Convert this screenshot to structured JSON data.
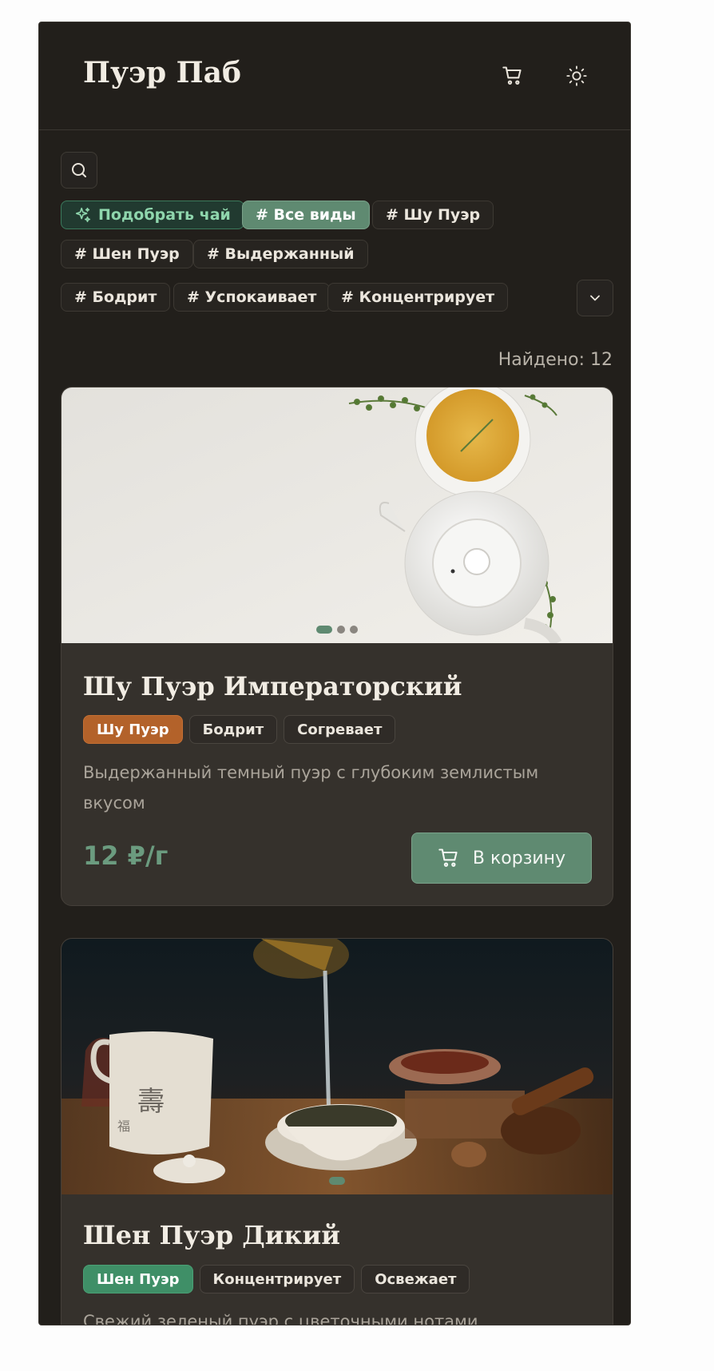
{
  "header": {
    "logo": "Пуэр Паб",
    "cart_icon": "cart-icon",
    "theme_icon": "sun-icon"
  },
  "filters": {
    "ai_label": "Подобрать чай",
    "chips": [
      "# Все виды",
      "# Шу Пуэр",
      "# Шен Пуэр",
      "# Выдержанный",
      "# Бодрит",
      "# Успокаивает",
      "# Концентрирует"
    ],
    "active_chip": "# Все виды"
  },
  "results": {
    "found_label": "Найдено: 12"
  },
  "products": [
    {
      "title": "Шу Пуэр Императорский",
      "tags": [
        "Шу Пуэр",
        "Бодрит",
        "Согревает"
      ],
      "description": "Выдержанный темный пуэр с глубоким землистым вкусом",
      "price": "12 ₽/г",
      "button_label": "В корзину",
      "image_dots": 3,
      "active_dot": 0
    },
    {
      "title": "Шен Пуэр Дикий",
      "tags": [
        "Шен Пуэр",
        "Концентрирует",
        "Освежает"
      ],
      "description": "Свежий зеленый пуэр с цветочными нотами",
      "image_dots": 1,
      "active_dot": 0
    }
  ],
  "colors": {
    "accent": "#5f8a71",
    "shu_tag": "#b3622a",
    "shen_tag": "#3f8f67",
    "background": "#221f1b"
  }
}
